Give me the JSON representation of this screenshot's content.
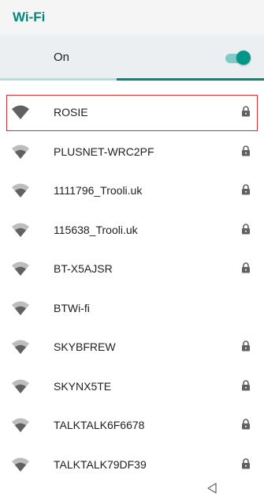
{
  "header": {
    "title": "Wi-Fi"
  },
  "switch": {
    "label": "On",
    "state": "on"
  },
  "colors": {
    "accent": "#00897b",
    "selection_outline": "#d32f2f"
  },
  "networks": [
    {
      "ssid": "ROSIE",
      "secured": true,
      "selected": true,
      "signal_icon": "wifi-strong-icon"
    },
    {
      "ssid": "PLUSNET-WRC2PF",
      "secured": true,
      "signal_icon": "wifi-medium-icon"
    },
    {
      "ssid": "1111796_Trooli.uk",
      "secured": true,
      "signal_icon": "wifi-medium-icon"
    },
    {
      "ssid": "115638_Trooli.uk",
      "secured": true,
      "signal_icon": "wifi-medium-icon"
    },
    {
      "ssid": "BT-X5AJSR",
      "secured": true,
      "signal_icon": "wifi-medium-icon"
    },
    {
      "ssid": "BTWi-fi",
      "secured": false,
      "signal_icon": "wifi-medium-icon"
    },
    {
      "ssid": "SKYBFREW",
      "secured": true,
      "signal_icon": "wifi-medium-icon"
    },
    {
      "ssid": "SKYNX5TE",
      "secured": true,
      "signal_icon": "wifi-medium-icon"
    },
    {
      "ssid": "TALKTALK6F6678",
      "secured": true,
      "signal_icon": "wifi-medium-icon"
    },
    {
      "ssid": "TALKTALK79DF39",
      "secured": true,
      "signal_icon": "wifi-medium-icon"
    }
  ],
  "navbar": {
    "back_icon": "back-triangle-icon"
  }
}
